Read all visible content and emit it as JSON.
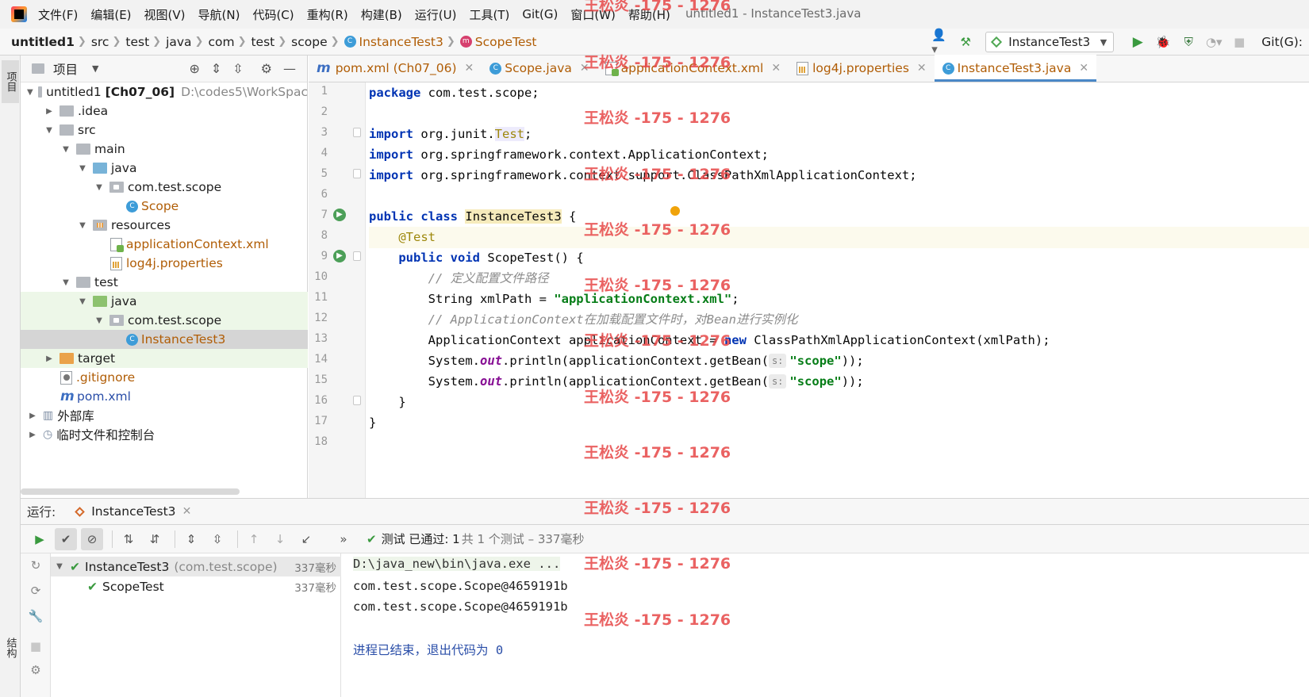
{
  "menubar": {
    "items": [
      "文件(F)",
      "编辑(E)",
      "视图(V)",
      "导航(N)",
      "代码(C)",
      "重构(R)",
      "构建(B)",
      "运行(U)",
      "工具(T)",
      "Git(G)",
      "窗口(W)",
      "帮助(H)"
    ],
    "window_title": "untitled1 - InstanceTest3.java"
  },
  "navbar": {
    "crumbs": [
      "untitled1",
      "src",
      "test",
      "java",
      "com",
      "test",
      "scope",
      "InstanceTest3",
      "ScopeTest"
    ],
    "run_config": "InstanceTest3",
    "git_label": "Git(G):"
  },
  "left_strip": {
    "project_tab": "项目",
    "structure_tab": "结构"
  },
  "project": {
    "title": "项目",
    "tree": [
      {
        "label": "untitled1",
        "extra_bold": "[Ch07_06]",
        "path": "D:\\codes5\\WorkSpac"
      },
      {
        "label": ".idea"
      },
      {
        "label": "src"
      },
      {
        "label": "main"
      },
      {
        "label": "java"
      },
      {
        "label": "com.test.scope"
      },
      {
        "label": "Scope"
      },
      {
        "label": "resources"
      },
      {
        "label": "applicationContext.xml"
      },
      {
        "label": "log4j.properties"
      },
      {
        "label": "test"
      },
      {
        "label": "java"
      },
      {
        "label": "com.test.scope"
      },
      {
        "label": "InstanceTest3"
      },
      {
        "label": "target"
      },
      {
        "label": ".gitignore"
      },
      {
        "label": "pom.xml"
      },
      {
        "label": "外部库"
      },
      {
        "label": "临时文件和控制台"
      }
    ]
  },
  "tabs": [
    {
      "label": "pom.xml (Ch07_06)"
    },
    {
      "label": "Scope.java"
    },
    {
      "label": "applicationContext.xml"
    },
    {
      "label": "log4j.properties"
    },
    {
      "label": "InstanceTest3.java"
    }
  ],
  "editor": {
    "line_numbers": [
      "1",
      "2",
      "3",
      "4",
      "5",
      "6",
      "7",
      "8",
      "9",
      "10",
      "11",
      "12",
      "13",
      "14",
      "15",
      "16",
      "17",
      "18"
    ],
    "code": {
      "l1_kw": "package",
      "l1_rest": " com.test.scope;",
      "l3_kw": "import",
      "l3_a": " org.junit.",
      "l3_b": "Test",
      "l3_c": ";",
      "l4_kw": "import",
      "l4_rest": " org.springframework.context.ApplicationContext;",
      "l5_kw": "import",
      "l5_rest": " org.springframework.context.support.ClassPathXmlApplicationContext;",
      "l7_kw1": "public",
      "l7_kw2": "class",
      "l7_cls": "InstanceTest3",
      "l7_rest": " {",
      "l8_ann": "@Test",
      "l9_kw1": "public",
      "l9_kw2": "void",
      "l9_rest": " ScopeTest() {",
      "l10_cmt": "// 定义配置文件路径",
      "l11_a": "String xmlPath = ",
      "l11_str": "\"applicationContext.xml\"",
      "l11_b": ";",
      "l12_cmt": "// ApplicationContext在加载配置文件时，对Bean进行实例化",
      "l13_a": "ApplicationContext applicationContext = ",
      "l13_kw": "new",
      "l13_b": " ClassPathXmlApplicationContext(xmlPath);",
      "l14_a": "System.",
      "l14_fld": "out",
      "l14_b": ".println(applicationContext.getBean(",
      "l14_hint": "s:",
      "l14_str": "\"scope\"",
      "l14_c": "));",
      "l15_a": "System.",
      "l15_fld": "out",
      "l15_b": ".println(applicationContext.getBean(",
      "l15_hint": "s:",
      "l15_str": "\"scope\"",
      "l15_c": "));",
      "l16": "}",
      "l17": "}"
    }
  },
  "run": {
    "label": "运行:",
    "tab": "InstanceTest3",
    "status_bold": "测试 已通过: 1",
    "status_rest": "共 1 个测试 – 337毫秒",
    "tree": [
      {
        "name": "InstanceTest3",
        "pkg": "(com.test.scope)",
        "time": "337毫秒"
      },
      {
        "name": "ScopeTest",
        "time": "337毫秒"
      }
    ],
    "console": [
      "D:\\java_new\\bin\\java.exe ...",
      "com.test.scope.Scope@4659191b",
      "com.test.scope.Scope@4659191b",
      "进程已结束，退出代码为 0"
    ]
  },
  "watermark": "王松炎 -175 - 1276",
  "colors": {
    "keyword": "#0033b3",
    "string": "#067d17",
    "comment": "#8c8c8c",
    "accent": "#4a88c7"
  }
}
